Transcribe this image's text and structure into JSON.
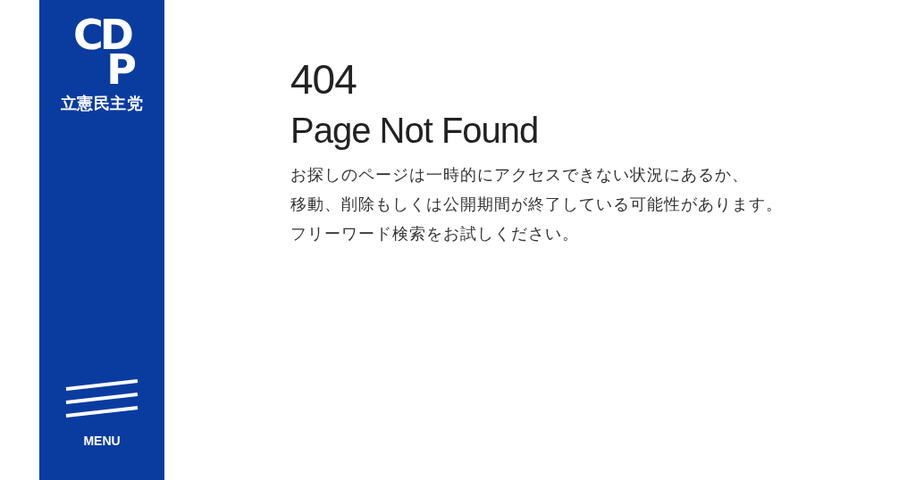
{
  "sidebar": {
    "logo": {
      "mark_lines": [
        "CD",
        "P"
      ],
      "party_name": "立憲民主党"
    },
    "menu": {
      "label": "MENU"
    }
  },
  "error": {
    "code": "404",
    "title": "Page Not Found",
    "message_lines": [
      "お探しのページは一時的にアクセスできない状況にあるか、",
      "移動、削除もしくは公開期間が終了している可能性があります。",
      "フリーワード検索をお試しください。"
    ]
  }
}
